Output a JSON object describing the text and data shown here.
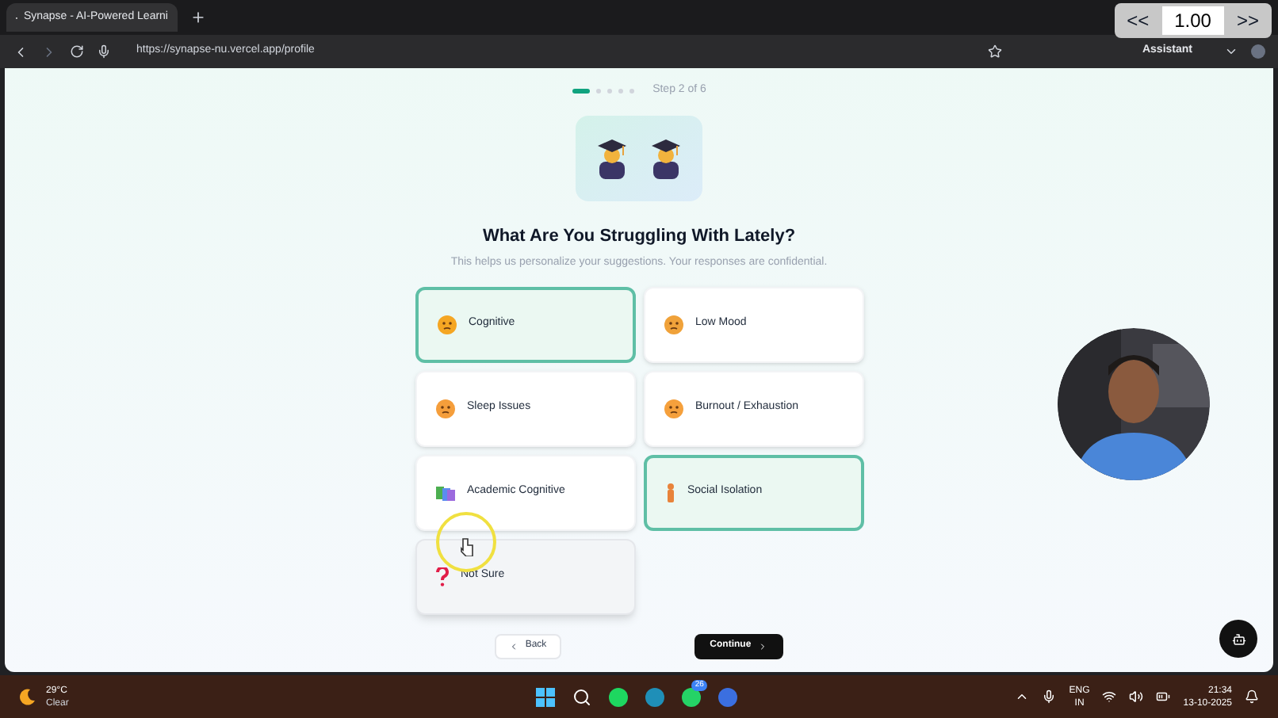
{
  "browser": {
    "tab_title": "Synapse - AI-Powered Learni",
    "url": "https://synapse-nu.vercel.app/profile",
    "assistant": "Assistant"
  },
  "playback": {
    "slower": "<<",
    "speed": "1.00",
    "faster": ">>"
  },
  "progress": {
    "dots": [
      {
        "selected": true
      },
      {
        "selected": false
      },
      {
        "selected": false
      },
      {
        "selected": false
      },
      {
        "selected": false
      }
    ],
    "label": "Step 2 of 6"
  },
  "title": "What Are You Struggling With Lately?",
  "subtitle": "This helps us personalize your suggestions. Your responses are confidential.",
  "options": [
    {
      "label": "Cognitive",
      "selected": true,
      "hovered": false
    },
    {
      "label": "Low Mood",
      "selected": false,
      "hovered": false
    },
    {
      "label": "Sleep Issues",
      "selected": false,
      "hovered": false
    },
    {
      "label": "Burnout / Exhaustion",
      "selected": false,
      "hovered": false
    },
    {
      "label": "Academic Cognitive",
      "selected": false,
      "hovered": false
    },
    {
      "label": "Social Isolation",
      "selected": true,
      "hovered": false
    },
    {
      "label": "Not Sure",
      "selected": false,
      "hovered": true
    }
  ],
  "buttons": {
    "back": "Back",
    "continue": "Continue"
  },
  "taskbar": {
    "temperature": "29°C",
    "weather": "Clear",
    "badge": "26",
    "lang": "ENG",
    "region": "IN",
    "time": "21:34",
    "date": "13-10-2025"
  }
}
